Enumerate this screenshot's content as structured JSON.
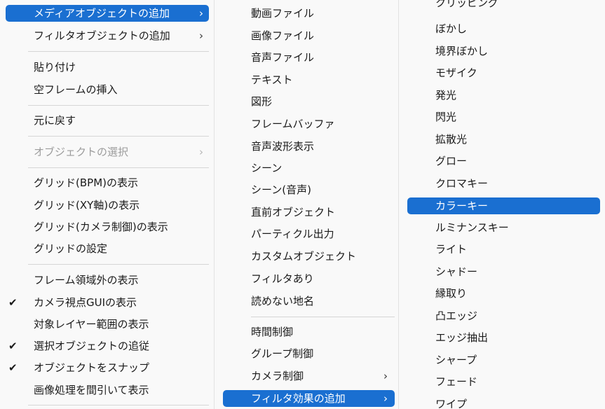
{
  "menu_main": {
    "items": [
      {
        "label": "メディアオブジェクトの追加",
        "arrow": "›"
      },
      {
        "label": "フィルタオブジェクトの追加",
        "arrow": "›"
      },
      {
        "label": "貼り付け"
      },
      {
        "label": "空フレームの挿入"
      },
      {
        "label": "元に戻す"
      },
      {
        "label": "オブジェクトの選択",
        "arrow": "›"
      },
      {
        "label": "グリッド(BPM)の表示"
      },
      {
        "label": "グリッド(XY軸)の表示"
      },
      {
        "label": "グリッド(カメラ制御)の表示"
      },
      {
        "label": "グリッドの設定"
      },
      {
        "label": "フレーム領域外の表示"
      },
      {
        "label": "カメラ視点GUIの表示",
        "check": "✔"
      },
      {
        "label": "対象レイヤー範囲の表示"
      },
      {
        "label": "選択オブジェクトの追従",
        "check": "✔"
      },
      {
        "label": "オブジェクトをスナップ",
        "check": "✔"
      },
      {
        "label": "画像処理を間引いて表示"
      }
    ]
  },
  "menu_media": {
    "items": [
      {
        "label": "動画ファイル"
      },
      {
        "label": "画像ファイル"
      },
      {
        "label": "音声ファイル"
      },
      {
        "label": "テキスト"
      },
      {
        "label": "図形"
      },
      {
        "label": "フレームバッファ"
      },
      {
        "label": "音声波形表示"
      },
      {
        "label": "シーン"
      },
      {
        "label": "シーン(音声)"
      },
      {
        "label": "直前オブジェクト"
      },
      {
        "label": "パーティクル出力"
      },
      {
        "label": "カスタムオブジェクト"
      },
      {
        "label": "フィルタあり"
      },
      {
        "label": "読めない地名"
      },
      {
        "label": "時間制御"
      },
      {
        "label": "グループ制御"
      },
      {
        "label": "カメラ制御",
        "arrow": "›"
      },
      {
        "label": "フィルタ効果の追加",
        "arrow": "›"
      }
    ]
  },
  "menu_filter": {
    "items": [
      {
        "label": "クリッピング"
      },
      {
        "label": "ぼかし"
      },
      {
        "label": "境界ぼかし"
      },
      {
        "label": "モザイク"
      },
      {
        "label": "発光"
      },
      {
        "label": "閃光"
      },
      {
        "label": "拡散光"
      },
      {
        "label": "グロー"
      },
      {
        "label": "クロマキー"
      },
      {
        "label": "カラーキー"
      },
      {
        "label": "ルミナンスキー"
      },
      {
        "label": "ライト"
      },
      {
        "label": "シャドー"
      },
      {
        "label": "縁取り"
      },
      {
        "label": "凸エッジ"
      },
      {
        "label": "エッジ抽出"
      },
      {
        "label": "シャープ"
      },
      {
        "label": "フェード"
      },
      {
        "label": "ワイプ"
      }
    ]
  }
}
